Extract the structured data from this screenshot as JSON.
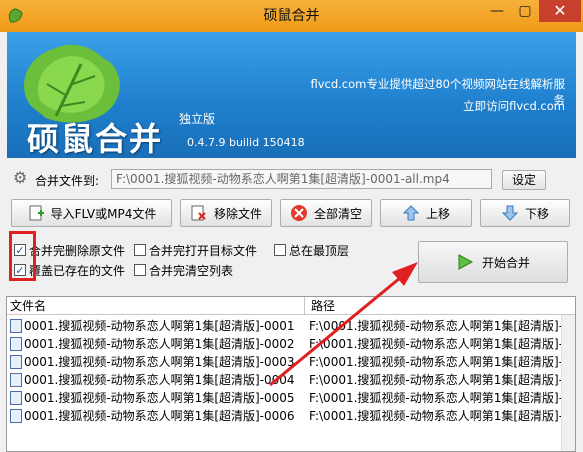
{
  "window": {
    "title": "硕鼠合并",
    "min": "—",
    "max": "▢",
    "close": "✕"
  },
  "banner": {
    "brand": "硕鼠合并",
    "edition": "独立版",
    "version": "0.4.7.9  builid 150418",
    "slogan": "flvcd.com专业提供超过80个视频网站在线解析服务",
    "visit": "立即访问flvcd.com"
  },
  "output": {
    "label": "合并文件到:",
    "value": "F:\\0001.搜狐视频-动物系恋人啊第1集[超清版]-0001-all.mp4",
    "settings": "设定"
  },
  "toolbar": {
    "import": "导入FLV或MP4文件",
    "remove": "移除文件",
    "clear": "全部清空",
    "up": "上移",
    "down": "下移"
  },
  "options": {
    "delete_source": {
      "label": "合并完删除原文件",
      "checked": true
    },
    "open_target": {
      "label": "合并完打开目标文件",
      "checked": false
    },
    "always_top": {
      "label": "总在最顶层",
      "checked": false
    },
    "overwrite": {
      "label": "覆盖已存在的文件",
      "checked": true
    },
    "clear_list": {
      "label": "合并完清空列表",
      "checked": false
    }
  },
  "start_button": "开始合并",
  "list": {
    "headers": {
      "name": "文件名",
      "path": "路径"
    },
    "rows": [
      {
        "name": "0001.搜狐视频-动物系恋人啊第1集[超清版]-0001",
        "path": "F:\\0001.搜狐视频-动物系恋人啊第1集[超清版]-"
      },
      {
        "name": "0001.搜狐视频-动物系恋人啊第1集[超清版]-0002",
        "path": "F:\\0001.搜狐视频-动物系恋人啊第1集[超清版]-"
      },
      {
        "name": "0001.搜狐视频-动物系恋人啊第1集[超清版]-0003",
        "path": "F:\\0001.搜狐视频-动物系恋人啊第1集[超清版]-"
      },
      {
        "name": "0001.搜狐视频-动物系恋人啊第1集[超清版]-0004",
        "path": "F:\\0001.搜狐视频-动物系恋人啊第1集[超清版]-"
      },
      {
        "name": "0001.搜狐视频-动物系恋人啊第1集[超清版]-0005",
        "path": "F:\\0001.搜狐视频-动物系恋人啊第1集[超清版]-"
      },
      {
        "name": "0001.搜狐视频-动物系恋人啊第1集[超清版]-0006",
        "path": "F:\\0001.搜狐视频-动物系恋人啊第1集[超清版]-"
      }
    ]
  },
  "colors": {
    "titlebar": "#f5a623",
    "banner": "#1e7ecc",
    "annotation": "#e02020"
  }
}
